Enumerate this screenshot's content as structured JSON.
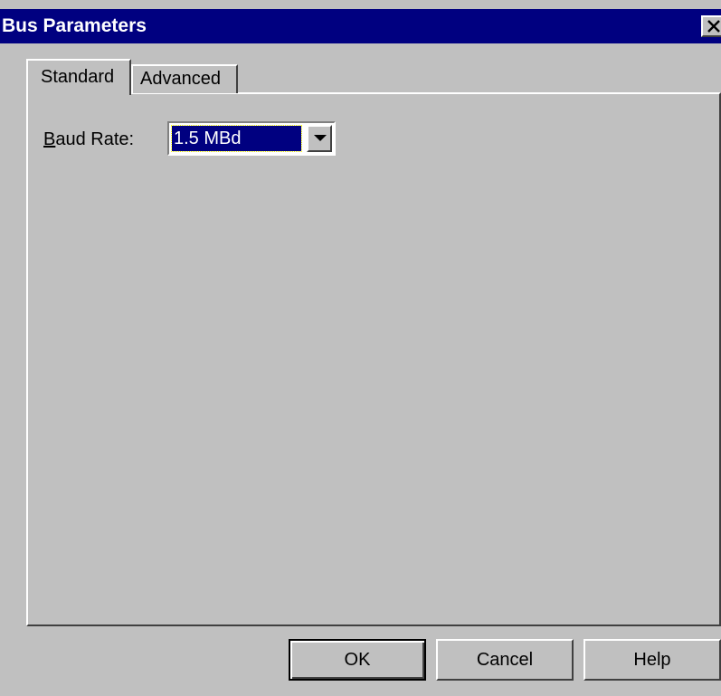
{
  "window": {
    "title": "Bus Parameters"
  },
  "tabs": [
    {
      "label": "Standard",
      "active": true
    },
    {
      "label": "Advanced",
      "active": false
    }
  ],
  "standard": {
    "baud_rate_label_accel": "B",
    "baud_rate_label_rest": "aud Rate:",
    "baud_rate_value": "1.5 MBd"
  },
  "buttons": {
    "ok": "OK",
    "cancel": "Cancel",
    "help": "Help"
  },
  "colors": {
    "titlebar": "#000080",
    "face": "#c0c0c0",
    "selection": "#000080"
  }
}
